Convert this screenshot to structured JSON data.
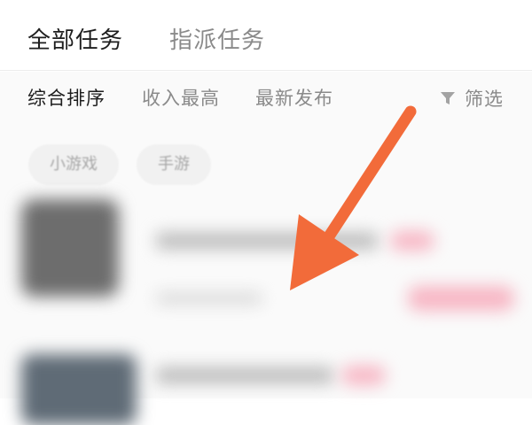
{
  "tabs": [
    {
      "label": "全部任务",
      "active": true
    },
    {
      "label": "指派任务",
      "active": false
    }
  ],
  "sort_options": [
    {
      "label": "综合排序",
      "active": true
    },
    {
      "label": "收入最高",
      "active": false
    },
    {
      "label": "最新发布",
      "active": false
    }
  ],
  "filter": {
    "label": "筛选",
    "icon": "filter-icon"
  },
  "chips": [
    {
      "label": "小游戏"
    },
    {
      "label": "手游"
    }
  ],
  "annotation": {
    "icon": "arrow-pointer",
    "color": "#F26B3A"
  },
  "colors": {
    "active_text": "#1e1e1e",
    "inactive_text": "#8a8a8a",
    "chip_bg": "#f1f1f1",
    "accent_pink": "#f7b6c4"
  }
}
